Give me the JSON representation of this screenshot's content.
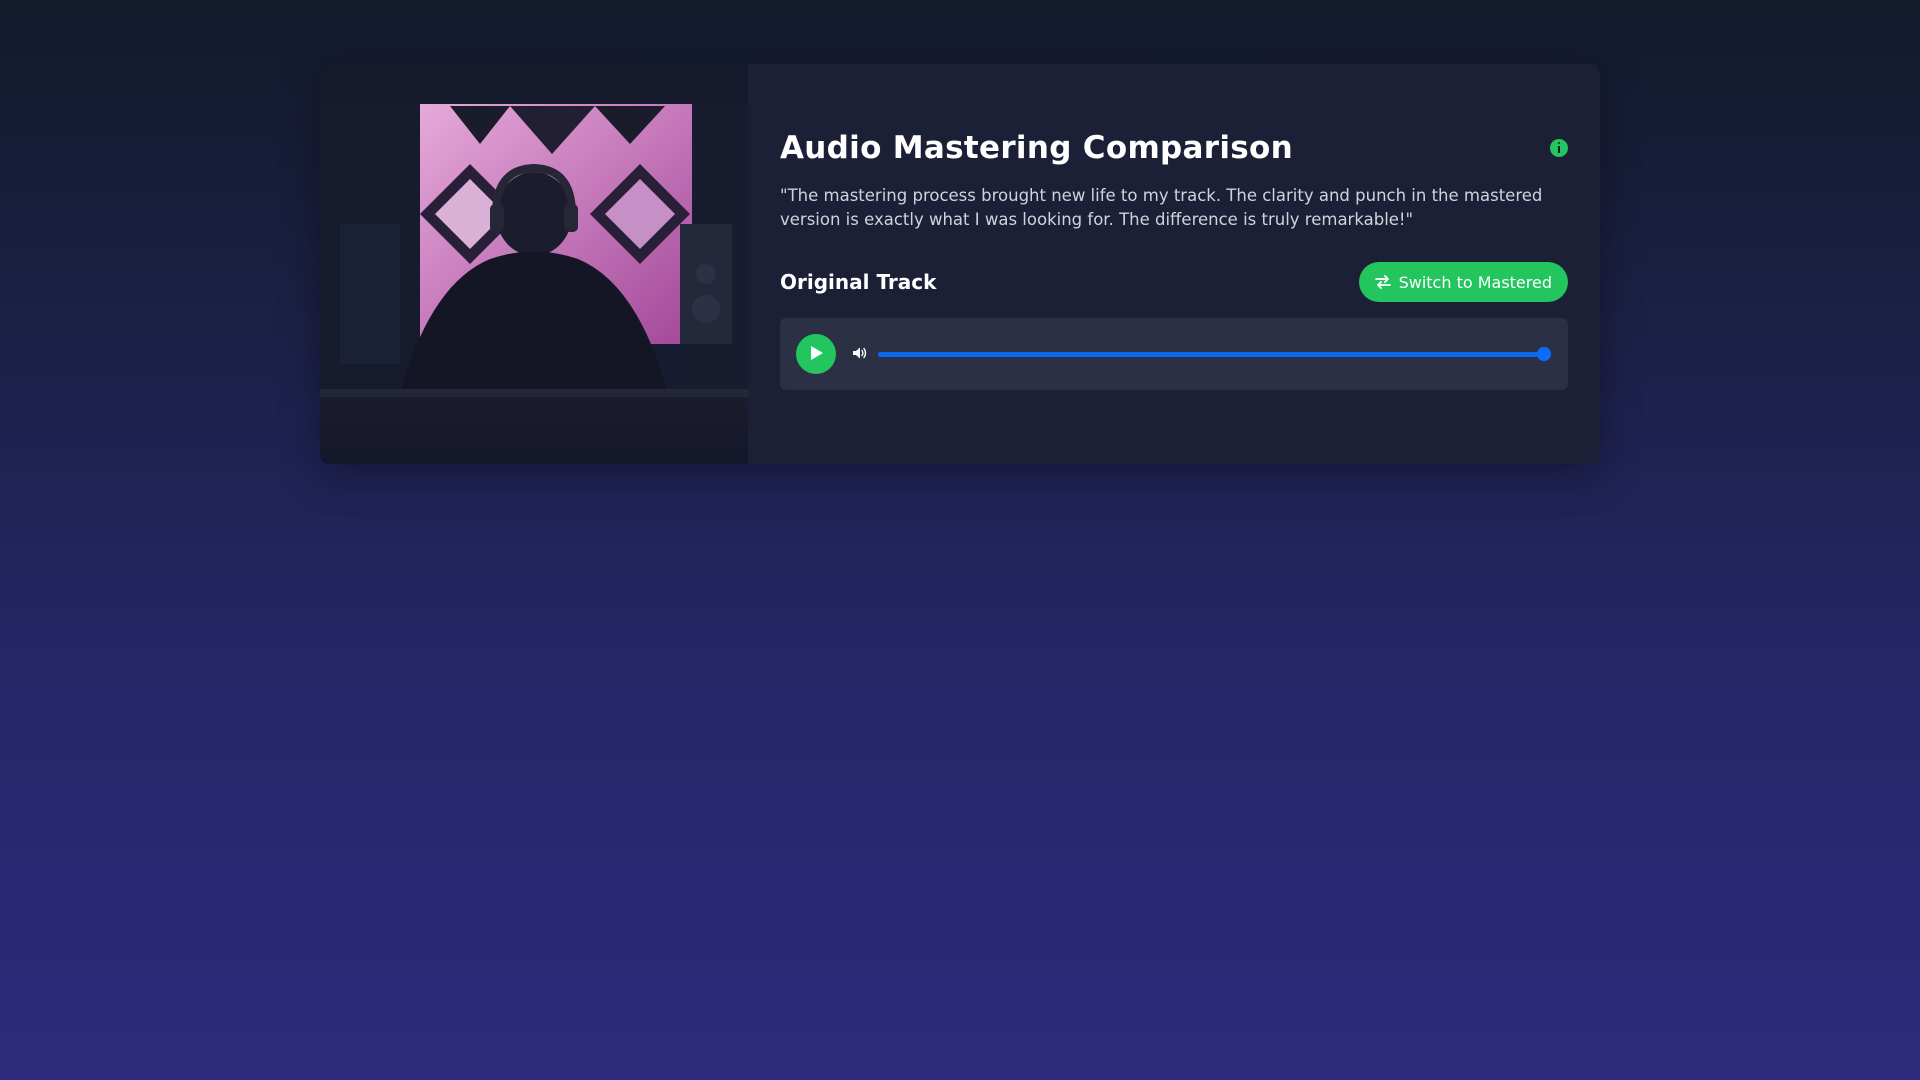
{
  "card": {
    "title": "Audio Mastering Comparison",
    "quote": "\"The mastering process brought new life to my track. The clarity and punch in the mastered version is exactly what I was looking for. The difference is truly remarkable!\"",
    "info_icon": "info-icon",
    "image_icon": "studio-photo"
  },
  "track": {
    "title": "Original Track",
    "switch_label": "Switch to Mastered",
    "switch_icon": "swap-arrows-icon"
  },
  "player": {
    "play_icon": "play-icon",
    "volume_icon": "volume-icon",
    "progress_fraction": 1.0
  },
  "colors": {
    "accent_green": "#22c55e",
    "progress_blue": "#0d6efd",
    "card_bg": "#1b2036",
    "player_bg": "#2b3045"
  }
}
